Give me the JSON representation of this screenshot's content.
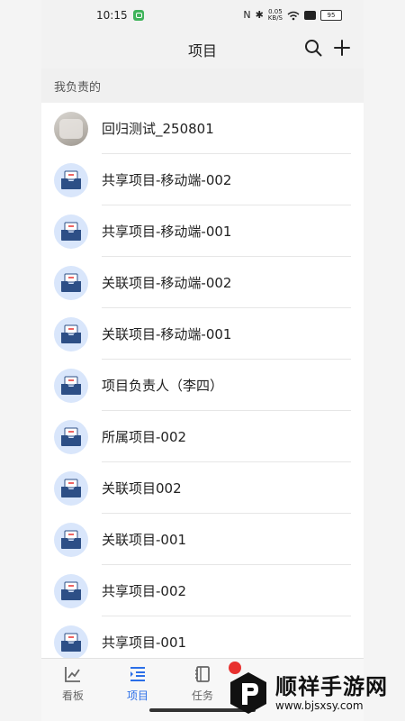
{
  "status_bar": {
    "time": "10:15",
    "speed_top": "0.05",
    "speed_unit": "KB/S",
    "battery": "95"
  },
  "header": {
    "title": "项目"
  },
  "section": {
    "title": "我负责的"
  },
  "items": [
    {
      "label": "回归测试_250801",
      "avatar": "photo"
    },
    {
      "label": "共享项目-移动端-002",
      "avatar": "project-box-icon"
    },
    {
      "label": "共享项目-移动端-001",
      "avatar": "project-box-icon"
    },
    {
      "label": "关联项目-移动端-002",
      "avatar": "project-box-icon"
    },
    {
      "label": "关联项目-移动端-001",
      "avatar": "project-box-icon"
    },
    {
      "label": "项目负责人（李四）",
      "avatar": "project-box-icon"
    },
    {
      "label": "所属项目-002",
      "avatar": "project-box-icon"
    },
    {
      "label": "关联项目002",
      "avatar": "project-box-icon"
    },
    {
      "label": "关联项目-001",
      "avatar": "project-box-icon"
    },
    {
      "label": "共享项目-002",
      "avatar": "project-box-icon"
    },
    {
      "label": "共享项目-001",
      "avatar": "project-box-icon"
    }
  ],
  "tabs": [
    {
      "label": "看板",
      "icon": "chart-icon",
      "active": false
    },
    {
      "label": "项目",
      "icon": "list-indent-icon",
      "active": true
    },
    {
      "label": "任务",
      "icon": "notebook-icon",
      "active": false
    }
  ],
  "watermark": {
    "name": "顺祥手游网",
    "url": "www.bjsxsy.com"
  },
  "colors": {
    "accent": "#2b6fe8",
    "avatar_bg": "#d9e6fb",
    "badge": "#e8312f"
  }
}
